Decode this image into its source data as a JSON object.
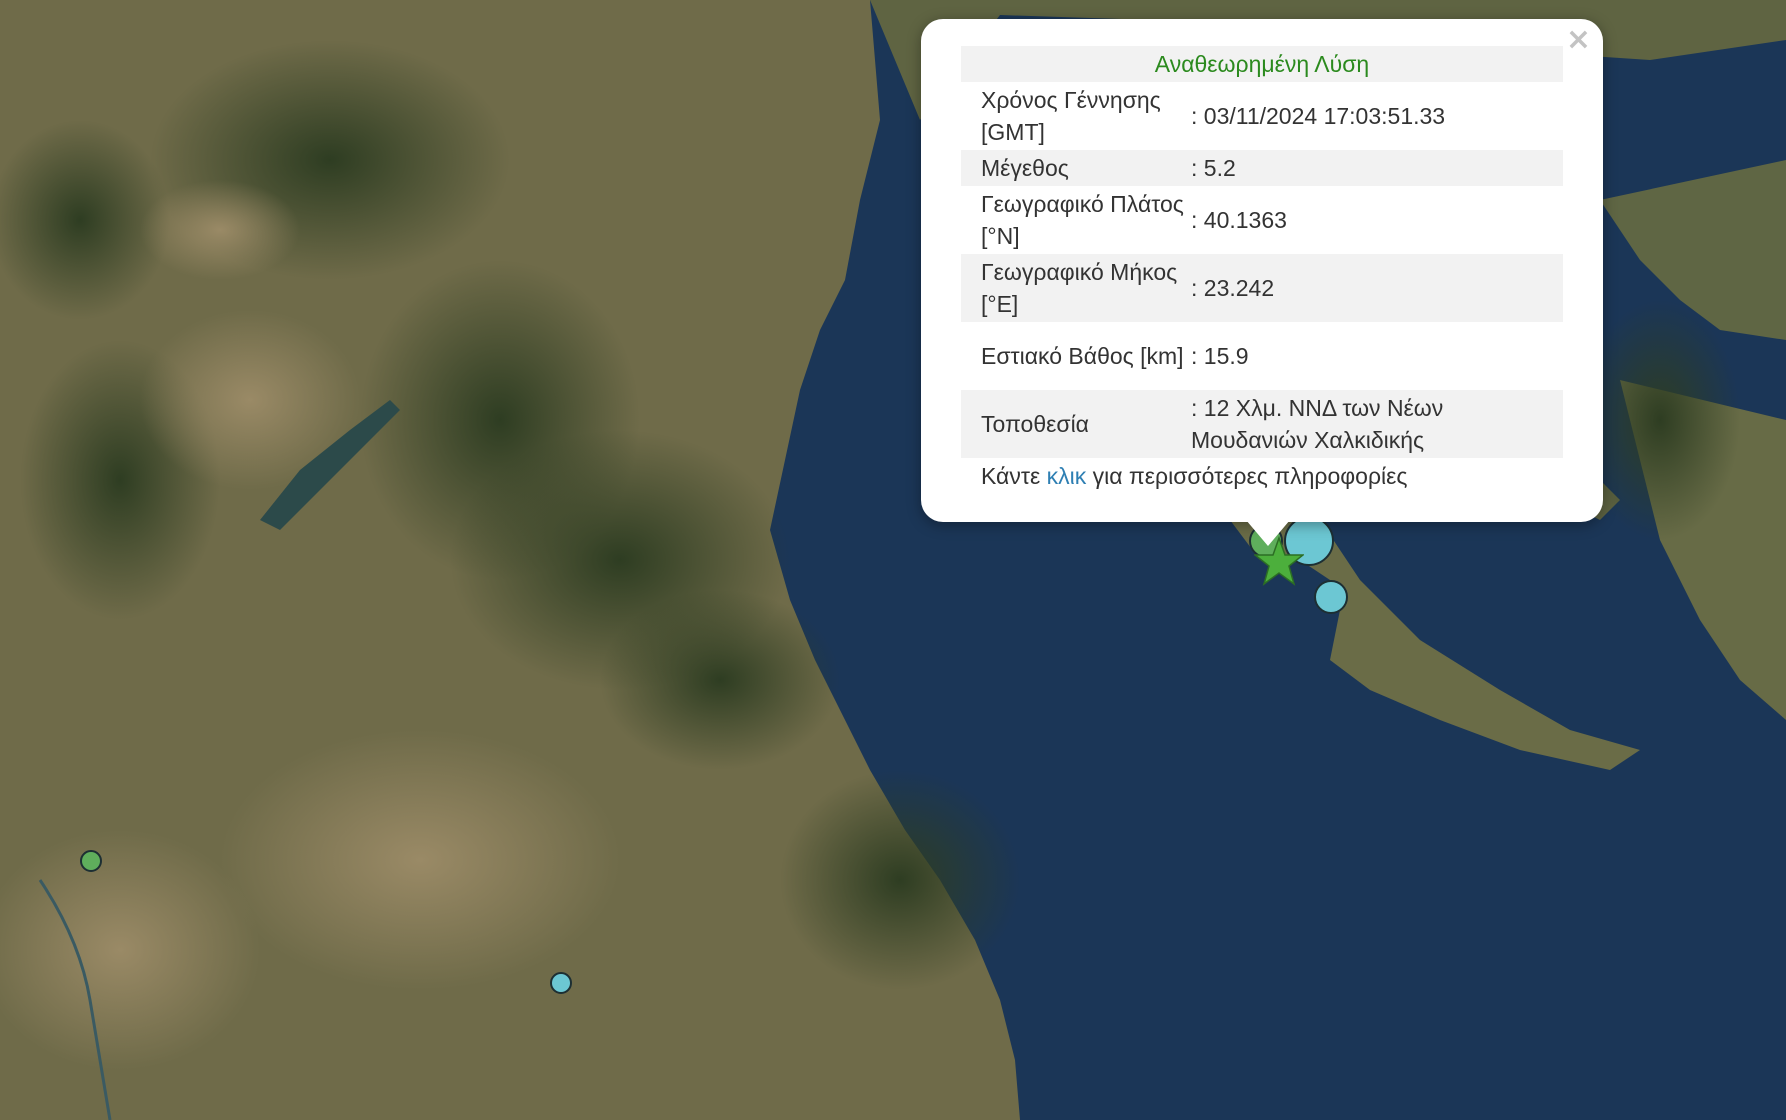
{
  "popup": {
    "title": "Αναθεωρημένη Λύση",
    "close_glyph": "×",
    "rows": [
      {
        "label": "Χρόνος Γέννησης [GMT]",
        "value": ": 03/11/2024 17:03:51.33"
      },
      {
        "label": "Μέγεθος",
        "value": ": 5.2"
      },
      {
        "label": "Γεωγραφικό Πλάτος [°N]",
        "value": ": 40.1363"
      },
      {
        "label": "Γεωγραφικό Μήκος [°E]",
        "value": ": 23.242"
      },
      {
        "label": "Εστιακό Βάθος [km]",
        "value": ": 15.9"
      },
      {
        "label": "Τοποθεσία",
        "value": ": 12 Χλμ. ΝΝΔ των Νέων Μουδανιών Χαλκιδικής"
      }
    ],
    "more": {
      "prefix": "Κάντε ",
      "link": "κλικ",
      "suffix": " για περισσότερες πληροφορίες"
    }
  },
  "map": {
    "colors": {
      "sea": "#1a3555",
      "land": "#6e6a48",
      "forest": "#3f4c2c",
      "marker_blue": "#6cc7d3",
      "marker_green": "#5fae5c",
      "star": "#4caf3c"
    },
    "markers": [
      "earthquake-epicenter-star",
      "event-marker-blue",
      "event-marker-green"
    ]
  }
}
